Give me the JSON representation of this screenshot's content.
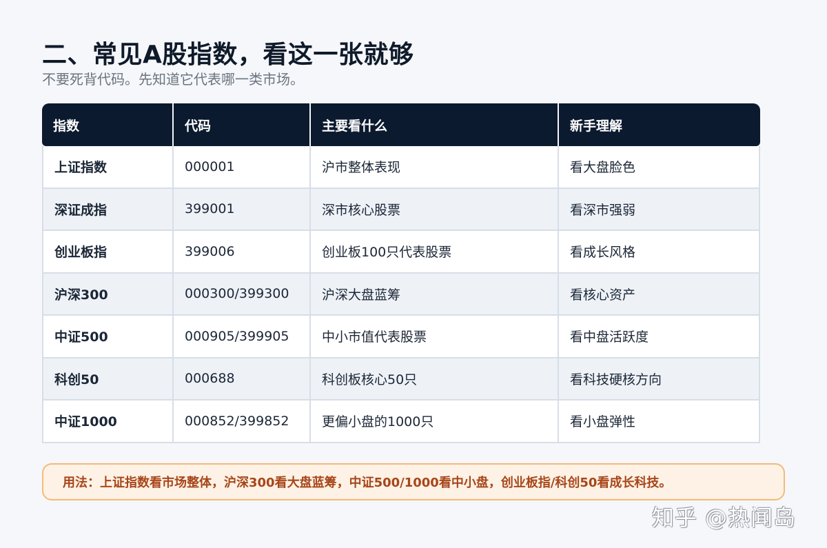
{
  "header": {
    "title": "二、常见A股指数，看这一张就够",
    "subtitle": "不要死背代码。先知道它代表哪一类市场。"
  },
  "table": {
    "columns": [
      "指数",
      "代码",
      "主要看什么",
      "新手理解"
    ],
    "rows": [
      [
        "上证指数",
        "000001",
        "沪市整体表现",
        "看大盘脸色"
      ],
      [
        "深证成指",
        "399001",
        "深市核心股票",
        "看深市强弱"
      ],
      [
        "创业板指",
        "399006",
        "创业板100只代表股票",
        "看成长风格"
      ],
      [
        "沪深300",
        "000300/399300",
        "沪深大盘蓝筹",
        "看核心资产"
      ],
      [
        "中证500",
        "000905/399905",
        "中小市值代表股票",
        "看中盘活跃度"
      ],
      [
        "科创50",
        "000688",
        "科创板核心50只",
        "看科技硬核方向"
      ],
      [
        "中证1000",
        "000852/399852",
        "更偏小盘的1000只",
        "看小盘弹性"
      ]
    ]
  },
  "note": {
    "text": "用法：上证指数看市场整体，沪深300看大盘蓝筹，中证500/1000看中小盘，创业板指/科创50看成长科技。"
  },
  "watermark": {
    "text": "知乎 @热闻岛"
  },
  "colors": {
    "header_bg": "#0b1a2e",
    "note_border": "#f5b97a",
    "note_text": "#a8461a"
  }
}
